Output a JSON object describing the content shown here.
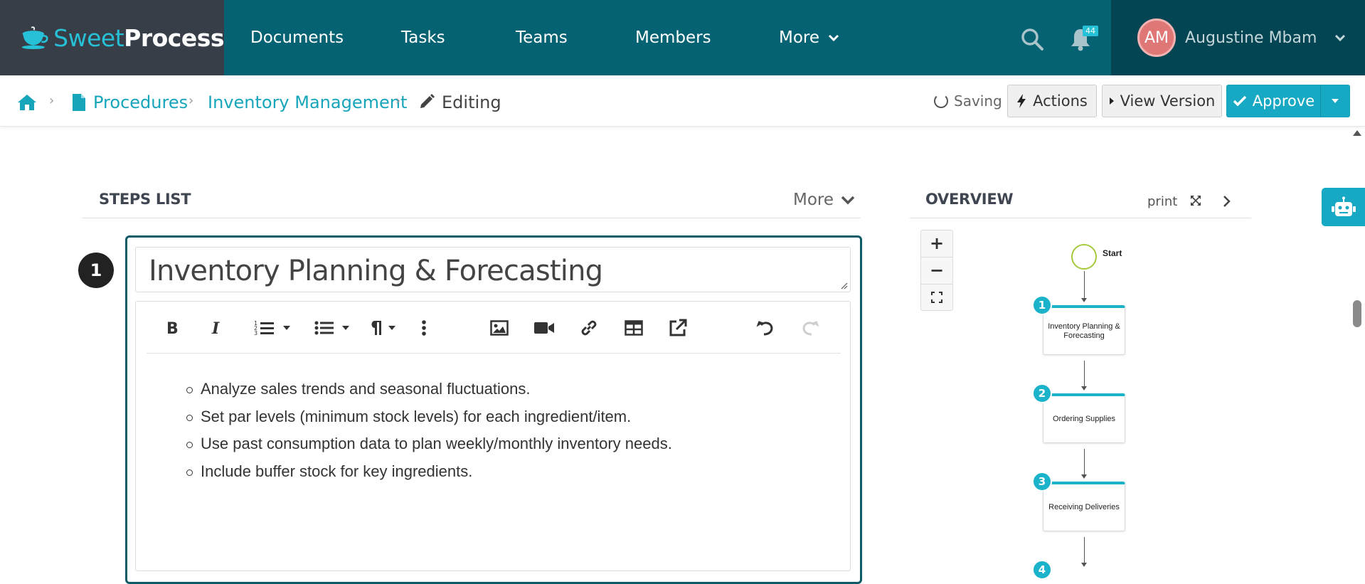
{
  "brand": {
    "part1": "Sweet",
    "part2": "Process"
  },
  "nav": {
    "items": [
      "Documents",
      "Tasks",
      "Teams",
      "Members",
      "More"
    ],
    "notifications_count": "44",
    "user": {
      "initials": "AM",
      "name": "Augustine Mbam"
    }
  },
  "breadcrumb": {
    "procedures": "Procedures",
    "procedure": "Inventory Management",
    "current": "Editing"
  },
  "actions": {
    "saving": "Saving",
    "actions_label": "Actions",
    "view_version_label": "View Version",
    "approve_label": "Approve"
  },
  "steps": {
    "header": "STEPS LIST",
    "more_label": "More",
    "current_step_number": "1",
    "current_step_title": "Inventory Planning & Forecasting",
    "content_bullets": [
      "Analyze sales trends and seasonal fluctuations.",
      "Set par levels (minimum stock levels) for each ingredient/item.",
      "Use past consumption data to plan weekly/monthly inventory needs.",
      "Include buffer stock for key ingredients."
    ],
    "toolbar_icons": [
      "bold-icon",
      "italic-icon",
      "ordered-list-icon",
      "unordered-list-icon",
      "paragraph-icon",
      "more-vertical-icon",
      "image-icon",
      "video-icon",
      "link-icon",
      "table-icon",
      "external-link-icon",
      "undo-icon",
      "redo-icon"
    ]
  },
  "overview": {
    "header": "OVERVIEW",
    "print_label": "print",
    "zoom_in": "+",
    "zoom_out": "−",
    "flow_start": "Start",
    "flow_steps": [
      {
        "num": "1",
        "label": "Inventory Planning & Forecasting"
      },
      {
        "num": "2",
        "label": "Ordering Supplies"
      },
      {
        "num": "3",
        "label": "Receiving Deliveries"
      },
      {
        "num": "4",
        "label": ""
      }
    ]
  },
  "colors": {
    "nav_bg": "#046272",
    "brand_bg": "#373e48",
    "user_bg": "#034552",
    "accent": "#17a8c3",
    "step_border": "#0e5a66"
  }
}
